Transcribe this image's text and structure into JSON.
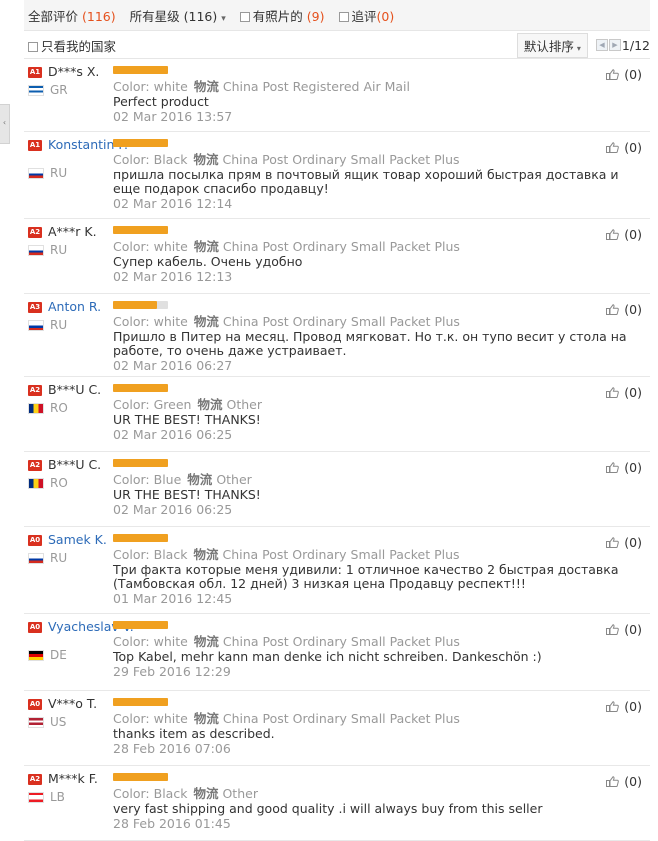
{
  "filters": {
    "all_label": "全部评价",
    "all_count": "(116)",
    "stars_label": "所有星级",
    "stars_count": "(116)",
    "photos_label": "有照片的",
    "photos_count": "(9)",
    "followup_label": "追评",
    "followup_count": "(0)"
  },
  "subbar": {
    "country_label": "只看我的国家",
    "sort_label": "默认排序",
    "page": "1/12"
  },
  "reviews": [
    {
      "badge": "A1",
      "name": "D***s X.",
      "country": "GR",
      "rating": 1.0,
      "color_label": "Color:",
      "color": "white",
      "ship_label": "物流",
      "shipping": "China Post Registered Air Mail",
      "text": "Perfect product",
      "date": "02 Mar 2016 13:57",
      "helpful": "(0)"
    },
    {
      "badge": "A1",
      "name": "Konstantin P.",
      "country": "RU",
      "rating": 1.0,
      "color_label": "Color:",
      "color": "Black",
      "ship_label": "物流",
      "shipping": "China Post Ordinary Small Packet Plus",
      "text": "пришла посылка прям в почтовый ящик товар хороший быстрая доставка и еще подарок спасибо продавцу!",
      "date": "02 Mar 2016 12:14",
      "helpful": "(0)"
    },
    {
      "badge": "A2",
      "name": "A***r K.",
      "country": "RU",
      "rating": 1.0,
      "color_label": "Color:",
      "color": "white",
      "ship_label": "物流",
      "shipping": "China Post Ordinary Small Packet Plus",
      "text": "Супер кабель. Очень удобно",
      "date": "02 Mar 2016 12:13",
      "helpful": "(0)"
    },
    {
      "badge": "A3",
      "name": "Anton R.",
      "country": "RU",
      "rating": 0.8,
      "color_label": "Color:",
      "color": "white",
      "ship_label": "物流",
      "shipping": "China Post Ordinary Small Packet Plus",
      "text": "Пришло в Питер на месяц. Провод мягковат. Но т.к. он тупо весит у стола на работе, то очень даже устраивает.",
      "date": "02 Mar 2016 06:27",
      "helpful": "(0)"
    },
    {
      "badge": "A2",
      "name": "B***U C.",
      "country": "RO",
      "rating": 1.0,
      "color_label": "Color:",
      "color": "Green",
      "ship_label": "物流",
      "shipping": "Other",
      "text": "UR THE BEST! THANKS!",
      "date": "02 Mar 2016 06:25",
      "helpful": "(0)"
    },
    {
      "badge": "A2",
      "name": "B***U C.",
      "country": "RO",
      "rating": 1.0,
      "color_label": "Color:",
      "color": "Blue",
      "ship_label": "物流",
      "shipping": "Other",
      "text": "UR THE BEST! THANKS!",
      "date": "02 Mar 2016 06:25",
      "helpful": "(0)"
    },
    {
      "badge": "A0",
      "name": "Samek K.",
      "country": "RU",
      "rating": 1.0,
      "color_label": "Color:",
      "color": "Black",
      "ship_label": "物流",
      "shipping": "China Post Ordinary Small Packet Plus",
      "text": "Три факта которые меня удивили: 1 отличное качество 2 быстрая доставка (Тамбовская обл. 12 дней) 3 низкая цена Продавцу респект!!!",
      "date": "01 Mar 2016 12:45",
      "helpful": "(0)"
    },
    {
      "badge": "A0",
      "name": "Vyacheslav V.",
      "country": "DE",
      "rating": 1.0,
      "color_label": "Color:",
      "color": "white",
      "ship_label": "物流",
      "shipping": "China Post Ordinary Small Packet Plus",
      "text": "Top Kabel, mehr kann man denke ich nicht schreiben. Dankeschön :)",
      "date": "29 Feb 2016 12:29",
      "helpful": "(0)"
    },
    {
      "badge": "A0",
      "name": "V***o T.",
      "country": "US",
      "rating": 1.0,
      "color_label": "Color:",
      "color": "white",
      "ship_label": "物流",
      "shipping": "China Post Ordinary Small Packet Plus",
      "text": "thanks item as described.",
      "date": "28 Feb 2016 07:06",
      "helpful": "(0)"
    },
    {
      "badge": "A2",
      "name": "M***k F.",
      "country": "LB",
      "rating": 1.0,
      "color_label": "Color:",
      "color": "Black",
      "ship_label": "物流",
      "shipping": "Other",
      "text": "very fast shipping and good quality .i will always buy from this seller",
      "date": "28 Feb 2016 01:45",
      "helpful": "(0)"
    }
  ]
}
